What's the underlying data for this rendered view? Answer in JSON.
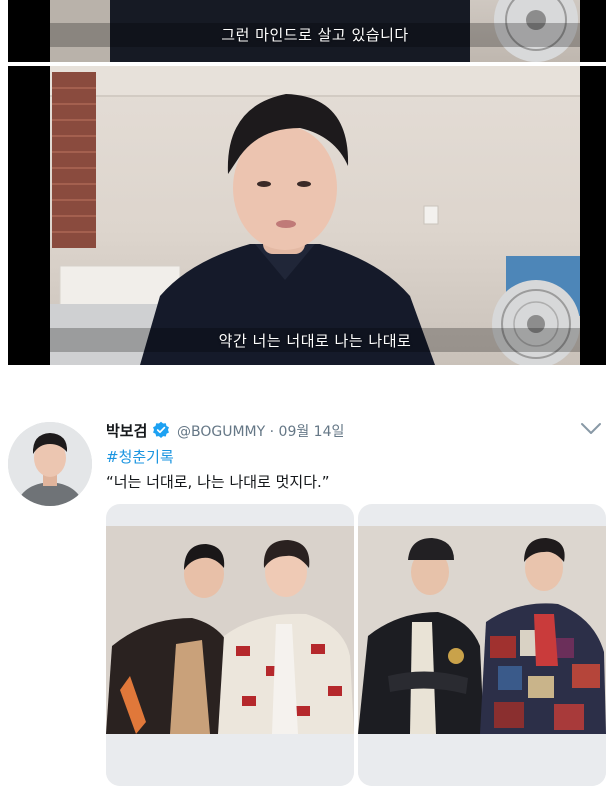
{
  "video": {
    "top_frame": {
      "subtitle": "그런 마인드로 살고 있습니다"
    },
    "main_frame": {
      "subtitle": "약간 너는 너대로 나는 나대로"
    }
  },
  "tweet": {
    "author_name": "박보검",
    "verified": true,
    "handle_and_date": "@BOGUMMY · 09월 14일",
    "hashtag": "#청춘기록",
    "text": "“너는 너대로, 나는 나대로 멋지다.”",
    "caret_icon": "chevron-down-icon",
    "photos": [
      "photo-left",
      "photo-right"
    ]
  },
  "colors": {
    "link": "#1b95e0",
    "verified_badge": "#1da1f2",
    "handle": "#657786",
    "text": "#14171a"
  }
}
